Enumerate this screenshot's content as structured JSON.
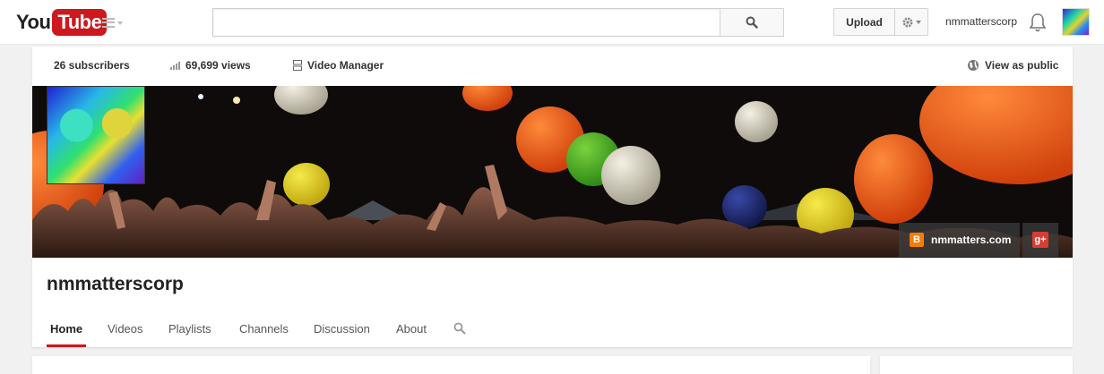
{
  "masthead": {
    "logo_you": "You",
    "logo_tube": "Tube",
    "search_placeholder": "",
    "upload_label": "Upload",
    "username": "nmmatterscorp",
    "icons": [
      "guide-menu-icon",
      "search-icon",
      "gear-icon",
      "bell-icon"
    ]
  },
  "stats": {
    "subscribers": "26 subscribers",
    "views": "69,699 views",
    "video_manager": "Video Manager",
    "view_as_public": "View as public"
  },
  "banner": {
    "blog_link": "nmmatters.com",
    "blog_icon": "B",
    "gplus_icon": "g+"
  },
  "channel": {
    "title": "nmmatterscorp"
  },
  "tabs": [
    {
      "label": "Home",
      "active": true
    },
    {
      "label": "Videos",
      "active": false
    },
    {
      "label": "Playlists",
      "active": false
    },
    {
      "label": "Channels",
      "active": false
    },
    {
      "label": "Discussion",
      "active": false
    },
    {
      "label": "About",
      "active": false
    }
  ],
  "colors": {
    "brand_red": "#cc181e",
    "blogger_orange": "#f57d00",
    "gplus_red": "#d73d32"
  }
}
